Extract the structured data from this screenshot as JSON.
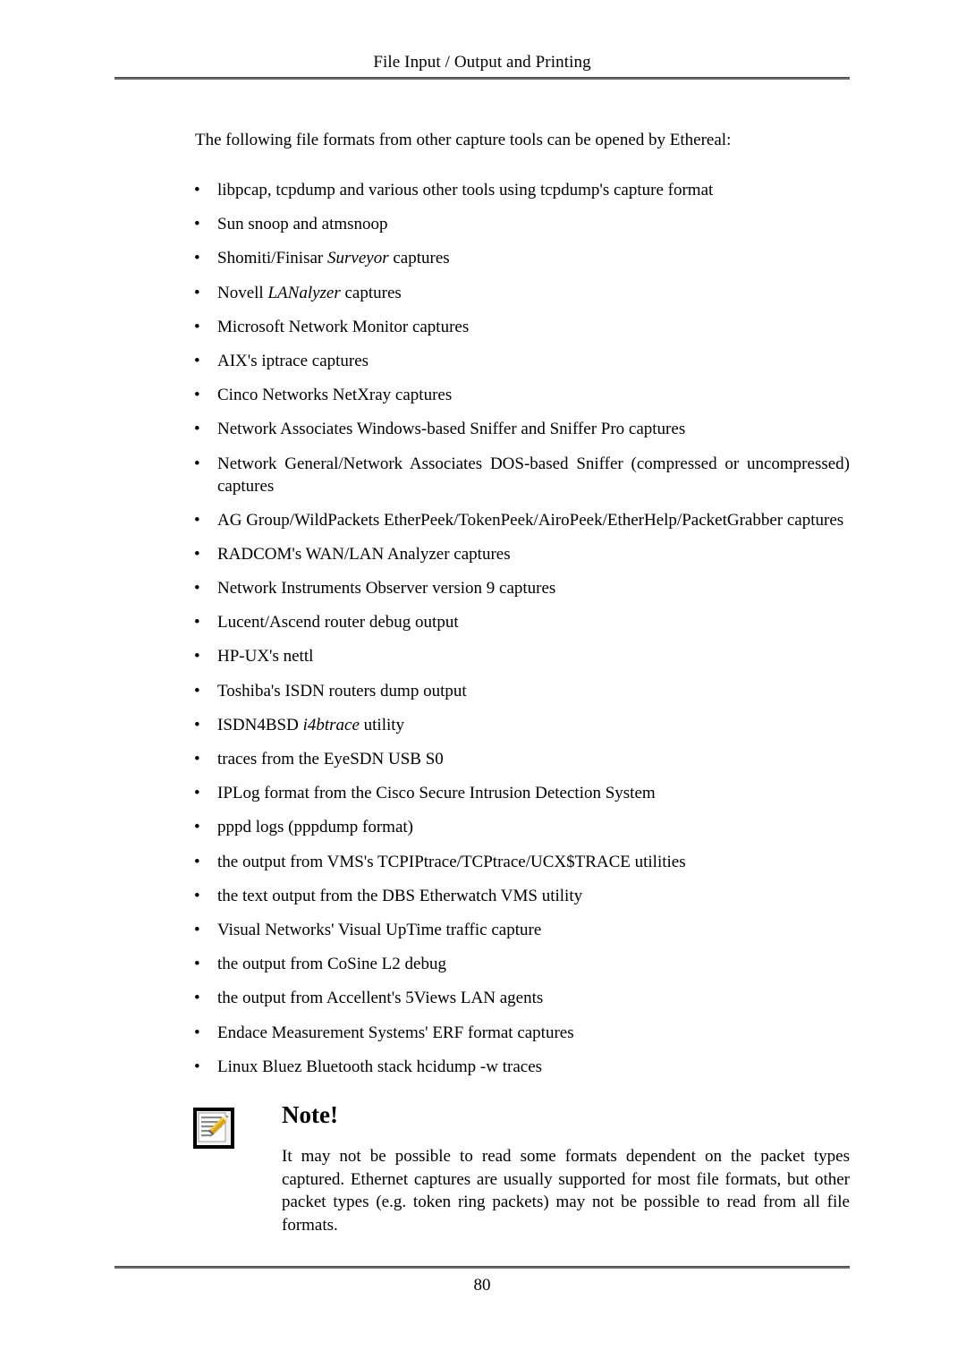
{
  "header": {
    "running_head": "File Input / Output and Printing"
  },
  "body": {
    "intro": "The following file formats from other capture tools can be opened by Ethereal:",
    "bullet_marker": "•",
    "bullets": [
      {
        "text": "libpcap, tcpdump and various other tools using tcpdump's capture format"
      },
      {
        "text": "Sun snoop and atmsnoop"
      },
      {
        "pre": "Shomiti/Finisar ",
        "italic": "Surveyor",
        "post": " captures"
      },
      {
        "pre": "Novell ",
        "italic": "LANalyzer",
        "post": " captures"
      },
      {
        "text": "Microsoft Network Monitor captures"
      },
      {
        "text": "AIX's iptrace captures"
      },
      {
        "text": "Cinco Networks NetXray captures"
      },
      {
        "text": "Network Associates Windows-based Sniffer and Sniffer Pro captures"
      },
      {
        "text": "Network General/Network Associates DOS-based Sniffer (compressed or uncompressed) captures"
      },
      {
        "text": "AG Group/WildPackets EtherPeek/TokenPeek/AiroPeek/EtherHelp/PacketGrabber captures"
      },
      {
        "text": "RADCOM's WAN/LAN Analyzer captures"
      },
      {
        "text": "Network Instruments Observer version 9 captures"
      },
      {
        "text": "Lucent/Ascend router debug output"
      },
      {
        "text": "HP-UX's nettl"
      },
      {
        "text": "Toshiba's ISDN routers dump output"
      },
      {
        "pre": "ISDN4BSD ",
        "italic": "i4btrace",
        "post": " utility"
      },
      {
        "text": "traces from the EyeSDN USB S0"
      },
      {
        "text": "IPLog format from the Cisco Secure Intrusion Detection System"
      },
      {
        "text": "pppd logs (pppdump format)"
      },
      {
        "text": "the output from VMS's TCPIPtrace/TCPtrace/UCX$TRACE utilities"
      },
      {
        "text": "the text output from the DBS Etherwatch VMS utility"
      },
      {
        "text": "Visual Networks' Visual UpTime traffic capture"
      },
      {
        "text": "the output from CoSine L2 debug"
      },
      {
        "text": "the output from Accellent's 5Views LAN agents"
      },
      {
        "text": "Endace Measurement Systems' ERF format captures"
      },
      {
        "text": "Linux Bluez Bluetooth stack hcidump -w traces"
      }
    ]
  },
  "note": {
    "icon": "note-pencil-icon",
    "title": "Note!",
    "text": "It may not be possible to read some formats dependent on the packet types captured. Ethernet captures are usually supported for most file formats, but other packet types (e.g. token ring packets) may not be possible to read from all file formats."
  },
  "footer": {
    "page_number": "80"
  },
  "colors": {
    "text": "#000000",
    "rule": "#6b6b6b",
    "background": "#ffffff",
    "icon_frame": "#000000",
    "icon_page": "#ffffff",
    "icon_lines": "#8a8a8a",
    "icon_pencil": "#d9a520"
  }
}
